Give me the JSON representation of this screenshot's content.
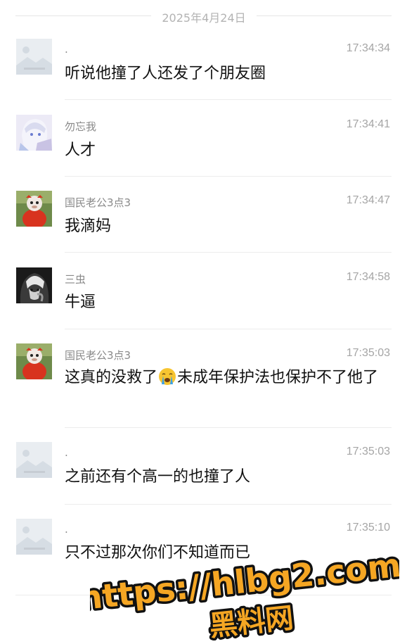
{
  "date_divider": "2025年4月24日",
  "messages": [
    {
      "sender": ".",
      "time": "17:34:34",
      "text": "听说他撞了人还发了个朋友圈",
      "avatar": "placeholder-image"
    },
    {
      "sender": "勿忘我",
      "time": "17:34:41",
      "text": "人才",
      "avatar": "anime-character"
    },
    {
      "sender": "国民老公3点3",
      "time": "17:34:47",
      "text": "我滴妈",
      "avatar": "monkey-red"
    },
    {
      "sender": "三虫",
      "time": "17:34:58",
      "text": "牛逼",
      "avatar": "dark-anime"
    },
    {
      "sender": "国民老公3点3",
      "time": "17:35:03",
      "text_before": "这真的没救了",
      "emoji": "crying-face-emoji",
      "text_after": "未成年保护法也保护不了他了",
      "avatar": "monkey-red"
    },
    {
      "sender": ".",
      "time": "17:35:03",
      "text": "之前还有个高一的也撞了人",
      "avatar": "placeholder-image"
    },
    {
      "sender": ".",
      "time": "17:35:10",
      "text": "只不过那次你们不知道而已",
      "avatar": "placeholder-image"
    }
  ],
  "watermark": {
    "line1": "https://hlbg2.com",
    "line2": "黑料网",
    "color": "#f5a623"
  }
}
